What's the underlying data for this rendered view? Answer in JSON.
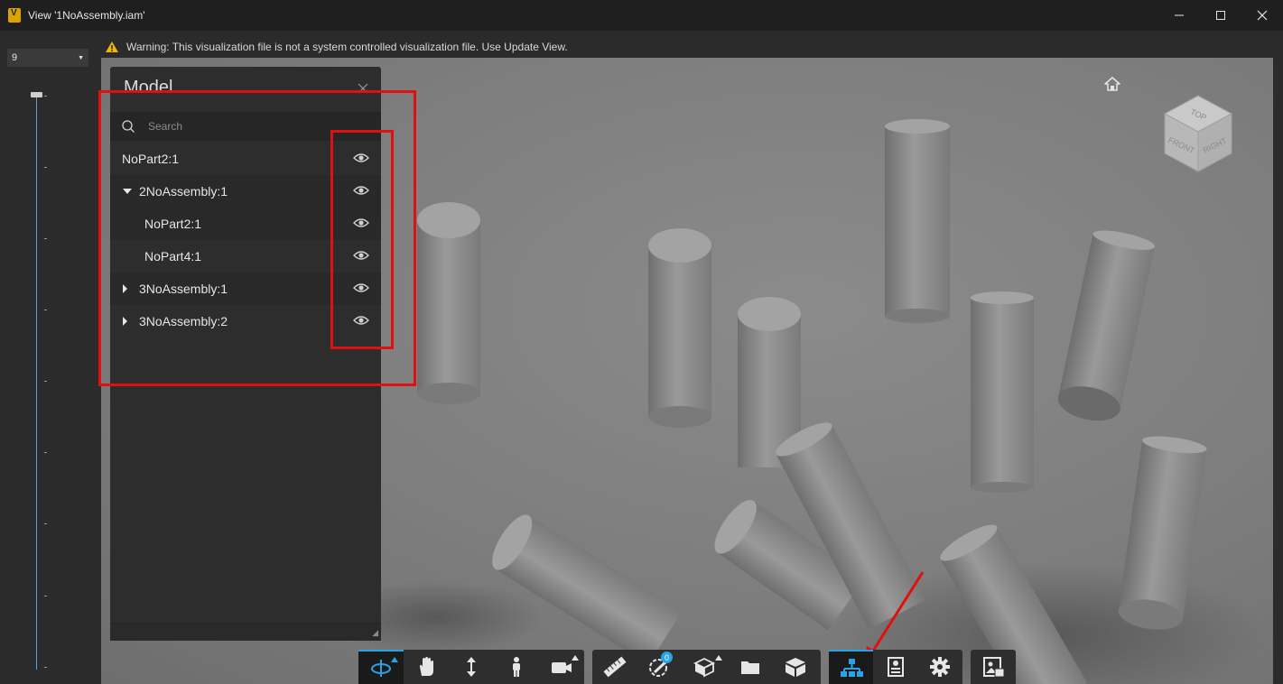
{
  "window": {
    "title": "View '1NoAssembly.iam'",
    "minimize_glyph": "—",
    "maximize_glyph": "☐",
    "close_glyph": "✕"
  },
  "level_select": {
    "value": "9"
  },
  "warning": {
    "text": "Warning: This visualization file is not a system controlled visualization file. Use Update View."
  },
  "model_panel": {
    "title": "Model",
    "search_placeholder": "Search",
    "items": [
      {
        "label": "NoPart2:1",
        "expander": "none",
        "visible_icon": "eye-icon"
      },
      {
        "label": "2NoAssembly:1",
        "expander": "expanded",
        "visible_icon": "eye-icon"
      },
      {
        "label": "NoPart2:1",
        "expander": "none",
        "visible_icon": "eye-icon"
      },
      {
        "label": "NoPart4:1",
        "expander": "none",
        "visible_icon": "eye-icon"
      },
      {
        "label": "3NoAssembly:1",
        "expander": "collapsed",
        "visible_icon": "eye-icon"
      },
      {
        "label": "3NoAssembly:2",
        "expander": "collapsed",
        "visible_icon": "eye-icon"
      }
    ]
  },
  "viewcube": {
    "top": "TOP",
    "front": "FRONT",
    "right": "RIGHT"
  },
  "toolbar": {
    "markup_count": "0",
    "groups": [
      [
        "orbit-icon",
        "pan-icon",
        "dolly-icon",
        "first-person-icon",
        "camera-icon"
      ],
      [
        "measure-icon",
        "markup-icon",
        "section-icon",
        "folder-icon",
        "explode-icon"
      ],
      [
        "model-browser-icon",
        "properties-icon",
        "settings-icon"
      ],
      [
        "export-icon"
      ]
    ]
  },
  "colors": {
    "accent": "#2aa3e6",
    "highlight": "#e01010",
    "viewport_bg": "#808080",
    "panel_bg": "#2d2d2d"
  }
}
